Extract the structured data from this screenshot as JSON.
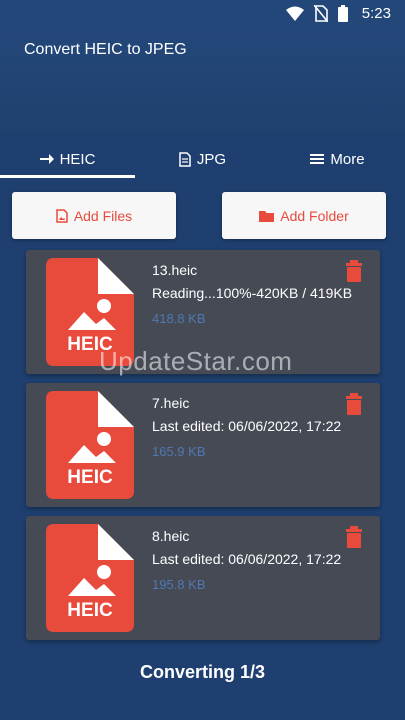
{
  "status_bar": {
    "time": "5:23"
  },
  "app_title": "Convert HEIC to JPEG",
  "tabs": [
    {
      "label": "HEIC",
      "icon": "arrow-right-icon",
      "active": true
    },
    {
      "label": "JPG",
      "icon": "document-icon",
      "active": false
    },
    {
      "label": "More",
      "icon": "list-icon",
      "active": false
    }
  ],
  "buttons": {
    "add_files": "Add Files",
    "add_folder": "Add Folder"
  },
  "files": [
    {
      "name": "13.heic",
      "info": "Reading...100%-420KB / 419KB",
      "size": "418.8 KB",
      "badge": "HEIC"
    },
    {
      "name": "7.heic",
      "info": "Last edited: 06/06/2022, 17:22",
      "size": "165.9 KB",
      "badge": "HEIC"
    },
    {
      "name": "8.heic",
      "info": "Last edited: 06/06/2022, 17:22",
      "size": "195.8 KB",
      "badge": "HEIC"
    }
  ],
  "watermark": "UpdateStar.com",
  "footer_status": "Converting 1/3",
  "colors": {
    "primary": "#1e3f6f",
    "accent": "#e84b3c",
    "card": "#454a55",
    "size_text": "#5078b2"
  }
}
